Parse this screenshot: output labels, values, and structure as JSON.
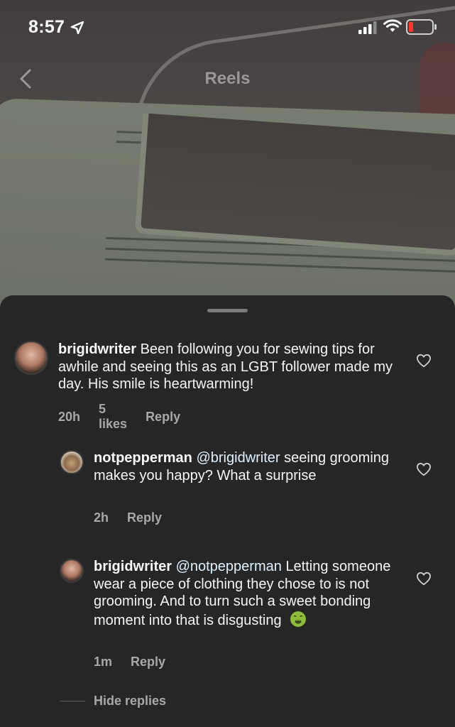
{
  "status_bar": {
    "time": "8:57",
    "battery_color": "#ff3b30"
  },
  "header": {
    "title": "Reels"
  },
  "comments": [
    {
      "username": "brigidwriter",
      "text": "Been following you for sewing tips for awhile and seeing this as an LGBT follower made my day. His smile is heartwarming!",
      "time": "20h",
      "likes": "5 likes",
      "reply_label": "Reply"
    },
    {
      "username": "notpepperman",
      "mention": "@brigidwriter",
      "text": "seeing grooming makes you happy? What a surprise",
      "time": "2h",
      "reply_label": "Reply"
    },
    {
      "username": "brigidwriter",
      "mention": "@notpepperman",
      "text": "Letting someone wear a piece of clothing they chose to is not grooming. And to turn such a sweet bonding moment into that is disgusting",
      "time": "1m",
      "reply_label": "Reply",
      "emoji": "nauseated-face-icon"
    }
  ],
  "hide_replies_label": "Hide replies",
  "colors": {
    "sheet_bg": "#262626",
    "mention": "#e0f1ff",
    "meta": "#a8a8a8"
  }
}
